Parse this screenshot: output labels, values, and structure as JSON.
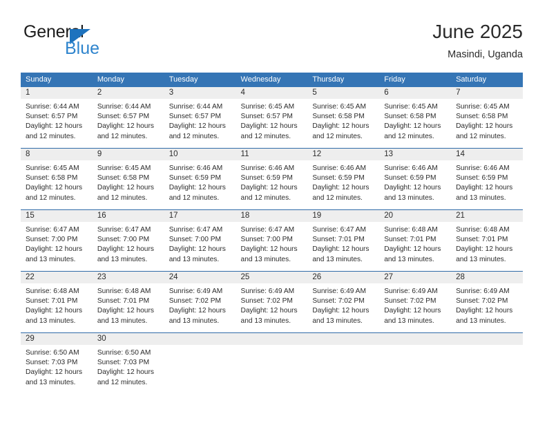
{
  "brand": {
    "name_part1": "General",
    "name_part2": "Blue",
    "logo_icon": "blue-triangle-icon",
    "color_dark": "#1c1c1c",
    "color_blue": "#2e84cd"
  },
  "header": {
    "title": "June 2025",
    "subtitle": "Masindi, Uganda"
  },
  "theme": {
    "header_row_bg": "#3575b5",
    "row_divider": "#2f6aa8",
    "daynum_band_bg": "#eeeeee",
    "text": "#2b2b2b"
  },
  "weekday_headers": [
    "Sunday",
    "Monday",
    "Tuesday",
    "Wednesday",
    "Thursday",
    "Friday",
    "Saturday"
  ],
  "labels": {
    "sunrise_prefix": "Sunrise:",
    "sunset_prefix": "Sunset:",
    "daylight_prefix": "Daylight:"
  },
  "weeks": [
    [
      {
        "day": "1",
        "sunrise": "Sunrise: 6:44 AM",
        "sunset": "Sunset: 6:57 PM",
        "daylight_l1": "Daylight: 12 hours",
        "daylight_l2": "and 12 minutes."
      },
      {
        "day": "2",
        "sunrise": "Sunrise: 6:44 AM",
        "sunset": "Sunset: 6:57 PM",
        "daylight_l1": "Daylight: 12 hours",
        "daylight_l2": "and 12 minutes."
      },
      {
        "day": "3",
        "sunrise": "Sunrise: 6:44 AM",
        "sunset": "Sunset: 6:57 PM",
        "daylight_l1": "Daylight: 12 hours",
        "daylight_l2": "and 12 minutes."
      },
      {
        "day": "4",
        "sunrise": "Sunrise: 6:45 AM",
        "sunset": "Sunset: 6:57 PM",
        "daylight_l1": "Daylight: 12 hours",
        "daylight_l2": "and 12 minutes."
      },
      {
        "day": "5",
        "sunrise": "Sunrise: 6:45 AM",
        "sunset": "Sunset: 6:58 PM",
        "daylight_l1": "Daylight: 12 hours",
        "daylight_l2": "and 12 minutes."
      },
      {
        "day": "6",
        "sunrise": "Sunrise: 6:45 AM",
        "sunset": "Sunset: 6:58 PM",
        "daylight_l1": "Daylight: 12 hours",
        "daylight_l2": "and 12 minutes."
      },
      {
        "day": "7",
        "sunrise": "Sunrise: 6:45 AM",
        "sunset": "Sunset: 6:58 PM",
        "daylight_l1": "Daylight: 12 hours",
        "daylight_l2": "and 12 minutes."
      }
    ],
    [
      {
        "day": "8",
        "sunrise": "Sunrise: 6:45 AM",
        "sunset": "Sunset: 6:58 PM",
        "daylight_l1": "Daylight: 12 hours",
        "daylight_l2": "and 12 minutes."
      },
      {
        "day": "9",
        "sunrise": "Sunrise: 6:45 AM",
        "sunset": "Sunset: 6:58 PM",
        "daylight_l1": "Daylight: 12 hours",
        "daylight_l2": "and 12 minutes."
      },
      {
        "day": "10",
        "sunrise": "Sunrise: 6:46 AM",
        "sunset": "Sunset: 6:59 PM",
        "daylight_l1": "Daylight: 12 hours",
        "daylight_l2": "and 12 minutes."
      },
      {
        "day": "11",
        "sunrise": "Sunrise: 6:46 AM",
        "sunset": "Sunset: 6:59 PM",
        "daylight_l1": "Daylight: 12 hours",
        "daylight_l2": "and 12 minutes."
      },
      {
        "day": "12",
        "sunrise": "Sunrise: 6:46 AM",
        "sunset": "Sunset: 6:59 PM",
        "daylight_l1": "Daylight: 12 hours",
        "daylight_l2": "and 12 minutes."
      },
      {
        "day": "13",
        "sunrise": "Sunrise: 6:46 AM",
        "sunset": "Sunset: 6:59 PM",
        "daylight_l1": "Daylight: 12 hours",
        "daylight_l2": "and 13 minutes."
      },
      {
        "day": "14",
        "sunrise": "Sunrise: 6:46 AM",
        "sunset": "Sunset: 6:59 PM",
        "daylight_l1": "Daylight: 12 hours",
        "daylight_l2": "and 13 minutes."
      }
    ],
    [
      {
        "day": "15",
        "sunrise": "Sunrise: 6:47 AM",
        "sunset": "Sunset: 7:00 PM",
        "daylight_l1": "Daylight: 12 hours",
        "daylight_l2": "and 13 minutes."
      },
      {
        "day": "16",
        "sunrise": "Sunrise: 6:47 AM",
        "sunset": "Sunset: 7:00 PM",
        "daylight_l1": "Daylight: 12 hours",
        "daylight_l2": "and 13 minutes."
      },
      {
        "day": "17",
        "sunrise": "Sunrise: 6:47 AM",
        "sunset": "Sunset: 7:00 PM",
        "daylight_l1": "Daylight: 12 hours",
        "daylight_l2": "and 13 minutes."
      },
      {
        "day": "18",
        "sunrise": "Sunrise: 6:47 AM",
        "sunset": "Sunset: 7:00 PM",
        "daylight_l1": "Daylight: 12 hours",
        "daylight_l2": "and 13 minutes."
      },
      {
        "day": "19",
        "sunrise": "Sunrise: 6:47 AM",
        "sunset": "Sunset: 7:01 PM",
        "daylight_l1": "Daylight: 12 hours",
        "daylight_l2": "and 13 minutes."
      },
      {
        "day": "20",
        "sunrise": "Sunrise: 6:48 AM",
        "sunset": "Sunset: 7:01 PM",
        "daylight_l1": "Daylight: 12 hours",
        "daylight_l2": "and 13 minutes."
      },
      {
        "day": "21",
        "sunrise": "Sunrise: 6:48 AM",
        "sunset": "Sunset: 7:01 PM",
        "daylight_l1": "Daylight: 12 hours",
        "daylight_l2": "and 13 minutes."
      }
    ],
    [
      {
        "day": "22",
        "sunrise": "Sunrise: 6:48 AM",
        "sunset": "Sunset: 7:01 PM",
        "daylight_l1": "Daylight: 12 hours",
        "daylight_l2": "and 13 minutes."
      },
      {
        "day": "23",
        "sunrise": "Sunrise: 6:48 AM",
        "sunset": "Sunset: 7:01 PM",
        "daylight_l1": "Daylight: 12 hours",
        "daylight_l2": "and 13 minutes."
      },
      {
        "day": "24",
        "sunrise": "Sunrise: 6:49 AM",
        "sunset": "Sunset: 7:02 PM",
        "daylight_l1": "Daylight: 12 hours",
        "daylight_l2": "and 13 minutes."
      },
      {
        "day": "25",
        "sunrise": "Sunrise: 6:49 AM",
        "sunset": "Sunset: 7:02 PM",
        "daylight_l1": "Daylight: 12 hours",
        "daylight_l2": "and 13 minutes."
      },
      {
        "day": "26",
        "sunrise": "Sunrise: 6:49 AM",
        "sunset": "Sunset: 7:02 PM",
        "daylight_l1": "Daylight: 12 hours",
        "daylight_l2": "and 13 minutes."
      },
      {
        "day": "27",
        "sunrise": "Sunrise: 6:49 AM",
        "sunset": "Sunset: 7:02 PM",
        "daylight_l1": "Daylight: 12 hours",
        "daylight_l2": "and 13 minutes."
      },
      {
        "day": "28",
        "sunrise": "Sunrise: 6:49 AM",
        "sunset": "Sunset: 7:02 PM",
        "daylight_l1": "Daylight: 12 hours",
        "daylight_l2": "and 13 minutes."
      }
    ],
    [
      {
        "day": "29",
        "sunrise": "Sunrise: 6:50 AM",
        "sunset": "Sunset: 7:03 PM",
        "daylight_l1": "Daylight: 12 hours",
        "daylight_l2": "and 13 minutes."
      },
      {
        "day": "30",
        "sunrise": "Sunrise: 6:50 AM",
        "sunset": "Sunset: 7:03 PM",
        "daylight_l1": "Daylight: 12 hours",
        "daylight_l2": "and 12 minutes."
      },
      {
        "day": "",
        "sunrise": "",
        "sunset": "",
        "daylight_l1": "",
        "daylight_l2": ""
      },
      {
        "day": "",
        "sunrise": "",
        "sunset": "",
        "daylight_l1": "",
        "daylight_l2": ""
      },
      {
        "day": "",
        "sunrise": "",
        "sunset": "",
        "daylight_l1": "",
        "daylight_l2": ""
      },
      {
        "day": "",
        "sunrise": "",
        "sunset": "",
        "daylight_l1": "",
        "daylight_l2": ""
      },
      {
        "day": "",
        "sunrise": "",
        "sunset": "",
        "daylight_l1": "",
        "daylight_l2": ""
      }
    ]
  ]
}
